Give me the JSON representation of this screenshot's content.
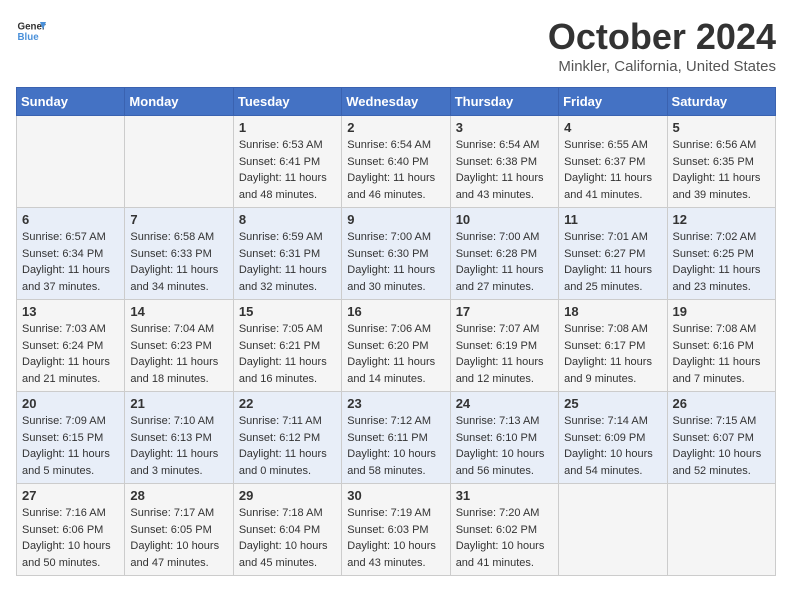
{
  "header": {
    "logo_general": "General",
    "logo_blue": "Blue",
    "title": "October 2024",
    "location": "Minkler, California, United States"
  },
  "weekdays": [
    "Sunday",
    "Monday",
    "Tuesday",
    "Wednesday",
    "Thursday",
    "Friday",
    "Saturday"
  ],
  "weeks": [
    [
      {
        "day": "",
        "info": ""
      },
      {
        "day": "",
        "info": ""
      },
      {
        "day": "1",
        "info": "Sunrise: 6:53 AM\nSunset: 6:41 PM\nDaylight: 11 hours and 48 minutes."
      },
      {
        "day": "2",
        "info": "Sunrise: 6:54 AM\nSunset: 6:40 PM\nDaylight: 11 hours and 46 minutes."
      },
      {
        "day": "3",
        "info": "Sunrise: 6:54 AM\nSunset: 6:38 PM\nDaylight: 11 hours and 43 minutes."
      },
      {
        "day": "4",
        "info": "Sunrise: 6:55 AM\nSunset: 6:37 PM\nDaylight: 11 hours and 41 minutes."
      },
      {
        "day": "5",
        "info": "Sunrise: 6:56 AM\nSunset: 6:35 PM\nDaylight: 11 hours and 39 minutes."
      }
    ],
    [
      {
        "day": "6",
        "info": "Sunrise: 6:57 AM\nSunset: 6:34 PM\nDaylight: 11 hours and 37 minutes."
      },
      {
        "day": "7",
        "info": "Sunrise: 6:58 AM\nSunset: 6:33 PM\nDaylight: 11 hours and 34 minutes."
      },
      {
        "day": "8",
        "info": "Sunrise: 6:59 AM\nSunset: 6:31 PM\nDaylight: 11 hours and 32 minutes."
      },
      {
        "day": "9",
        "info": "Sunrise: 7:00 AM\nSunset: 6:30 PM\nDaylight: 11 hours and 30 minutes."
      },
      {
        "day": "10",
        "info": "Sunrise: 7:00 AM\nSunset: 6:28 PM\nDaylight: 11 hours and 27 minutes."
      },
      {
        "day": "11",
        "info": "Sunrise: 7:01 AM\nSunset: 6:27 PM\nDaylight: 11 hours and 25 minutes."
      },
      {
        "day": "12",
        "info": "Sunrise: 7:02 AM\nSunset: 6:25 PM\nDaylight: 11 hours and 23 minutes."
      }
    ],
    [
      {
        "day": "13",
        "info": "Sunrise: 7:03 AM\nSunset: 6:24 PM\nDaylight: 11 hours and 21 minutes."
      },
      {
        "day": "14",
        "info": "Sunrise: 7:04 AM\nSunset: 6:23 PM\nDaylight: 11 hours and 18 minutes."
      },
      {
        "day": "15",
        "info": "Sunrise: 7:05 AM\nSunset: 6:21 PM\nDaylight: 11 hours and 16 minutes."
      },
      {
        "day": "16",
        "info": "Sunrise: 7:06 AM\nSunset: 6:20 PM\nDaylight: 11 hours and 14 minutes."
      },
      {
        "day": "17",
        "info": "Sunrise: 7:07 AM\nSunset: 6:19 PM\nDaylight: 11 hours and 12 minutes."
      },
      {
        "day": "18",
        "info": "Sunrise: 7:08 AM\nSunset: 6:17 PM\nDaylight: 11 hours and 9 minutes."
      },
      {
        "day": "19",
        "info": "Sunrise: 7:08 AM\nSunset: 6:16 PM\nDaylight: 11 hours and 7 minutes."
      }
    ],
    [
      {
        "day": "20",
        "info": "Sunrise: 7:09 AM\nSunset: 6:15 PM\nDaylight: 11 hours and 5 minutes."
      },
      {
        "day": "21",
        "info": "Sunrise: 7:10 AM\nSunset: 6:13 PM\nDaylight: 11 hours and 3 minutes."
      },
      {
        "day": "22",
        "info": "Sunrise: 7:11 AM\nSunset: 6:12 PM\nDaylight: 11 hours and 0 minutes."
      },
      {
        "day": "23",
        "info": "Sunrise: 7:12 AM\nSunset: 6:11 PM\nDaylight: 10 hours and 58 minutes."
      },
      {
        "day": "24",
        "info": "Sunrise: 7:13 AM\nSunset: 6:10 PM\nDaylight: 10 hours and 56 minutes."
      },
      {
        "day": "25",
        "info": "Sunrise: 7:14 AM\nSunset: 6:09 PM\nDaylight: 10 hours and 54 minutes."
      },
      {
        "day": "26",
        "info": "Sunrise: 7:15 AM\nSunset: 6:07 PM\nDaylight: 10 hours and 52 minutes."
      }
    ],
    [
      {
        "day": "27",
        "info": "Sunrise: 7:16 AM\nSunset: 6:06 PM\nDaylight: 10 hours and 50 minutes."
      },
      {
        "day": "28",
        "info": "Sunrise: 7:17 AM\nSunset: 6:05 PM\nDaylight: 10 hours and 47 minutes."
      },
      {
        "day": "29",
        "info": "Sunrise: 7:18 AM\nSunset: 6:04 PM\nDaylight: 10 hours and 45 minutes."
      },
      {
        "day": "30",
        "info": "Sunrise: 7:19 AM\nSunset: 6:03 PM\nDaylight: 10 hours and 43 minutes."
      },
      {
        "day": "31",
        "info": "Sunrise: 7:20 AM\nSunset: 6:02 PM\nDaylight: 10 hours and 41 minutes."
      },
      {
        "day": "",
        "info": ""
      },
      {
        "day": "",
        "info": ""
      }
    ]
  ]
}
